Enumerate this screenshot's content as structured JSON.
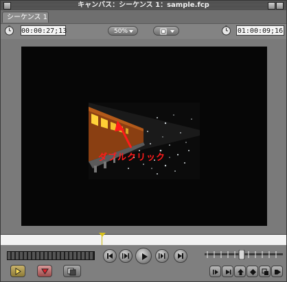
{
  "window": {
    "title": "キャンバス：シーケンス 1：sample.fcp"
  },
  "tab": {
    "label": "シーケンス 1"
  },
  "toolbar": {
    "current_timecode": "00:00:27;13",
    "zoom_level": "50%",
    "duration_timecode": "01:00:09;16"
  },
  "annotation": {
    "label": "ダブルクリック",
    "color": "#ff1b1b"
  },
  "colors": {
    "playhead": "#d8c21a",
    "canvas_bg": "#060606"
  },
  "icons": [
    "clock-icon",
    "view-mode-icon",
    "go-to-previous-edit-icon",
    "play-in-to-out-icon",
    "play-icon",
    "play-around-icon",
    "go-to-next-edit-icon",
    "mark-in-icon",
    "mark-out-icon",
    "match-frame-icon",
    "insert-icon",
    "overwrite-icon",
    "replace-icon",
    "fit-to-fill-icon",
    "superimpose-icon"
  ]
}
